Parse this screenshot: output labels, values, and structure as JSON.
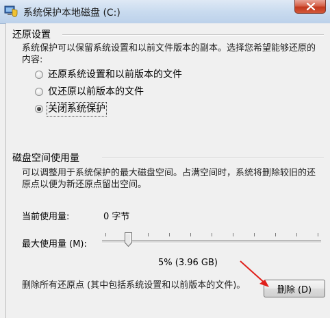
{
  "window": {
    "title": "系统保护本地磁盘 (C:)"
  },
  "restore": {
    "heading": "还原设置",
    "description": "系统保护可以保留系统设置和以前文件版本的副本。选择您希望能够还原的内容:",
    "options": [
      {
        "label": "还原系统设置和以前版本的文件",
        "checked": false
      },
      {
        "label": "仅还原以前版本的文件",
        "checked": false
      },
      {
        "label": "关闭系统保护",
        "checked": true
      }
    ]
  },
  "disk": {
    "heading": "磁盘空间使用量",
    "description": "可以调整用于系统保护的最大磁盘空间。占满空间时，系统将删除较旧的还原点以便为新还原点留出空间。",
    "current_label": "当前使用量:",
    "current_value": "0 字节",
    "max_label": "最大使用量 (M):",
    "max_percent": 5,
    "slider_value_text": "5% (3.96 GB)"
  },
  "delete": {
    "description": "删除所有还原点 (其中包括系统设置和以前版本的文件)。",
    "button_label": "删除 (D)"
  },
  "colors": {
    "arrow": "#e0201b",
    "close_button": "#c9452b"
  },
  "icons": {
    "title": "system-protection-icon",
    "close": "close-icon",
    "arrow": "red-arrow-annotation"
  }
}
